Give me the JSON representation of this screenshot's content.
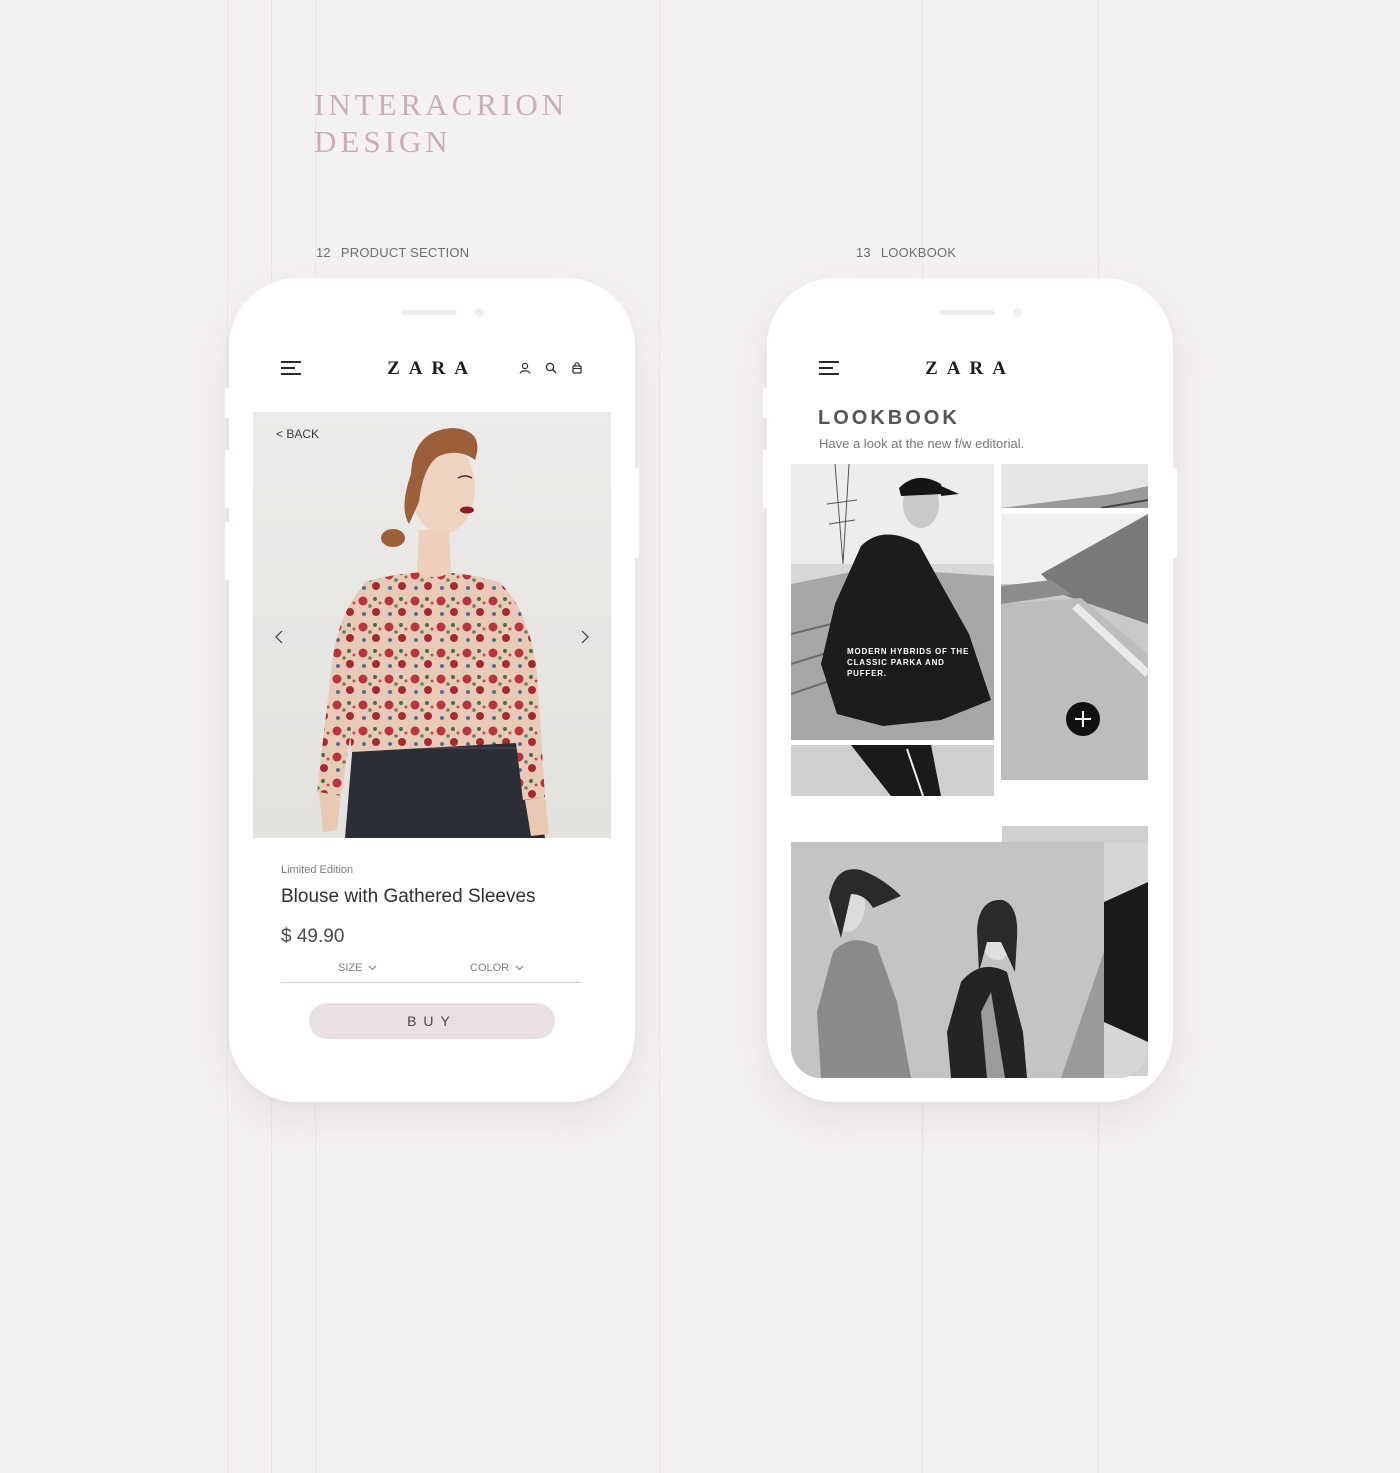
{
  "heading": {
    "line1": "INTERACRION",
    "line2": "DESIGN"
  },
  "sections": [
    {
      "number": "12",
      "label": "PRODUCT SECTION"
    },
    {
      "number": "13",
      "label": "LOOKBOOK"
    }
  ],
  "brand": "ZARA",
  "product": {
    "back_label": "< BACK",
    "subtitle": "Limited Edition",
    "title": "Blouse with Gathered Sleeves",
    "price": "$ 49.90",
    "size_label": "SIZE",
    "color_label": "COLOR",
    "buy_label": "BUY"
  },
  "lookbook": {
    "title": "LOOKBOOK",
    "description": "Have a look at the new f/w editorial.",
    "caption": "MODERN HYBRIDS OF THE CLASSIC PARKA AND PUFFER."
  },
  "colors": {
    "background": "#f4f1f2",
    "heading": "#c9aeb3",
    "buy_button": "#eadfe1"
  }
}
